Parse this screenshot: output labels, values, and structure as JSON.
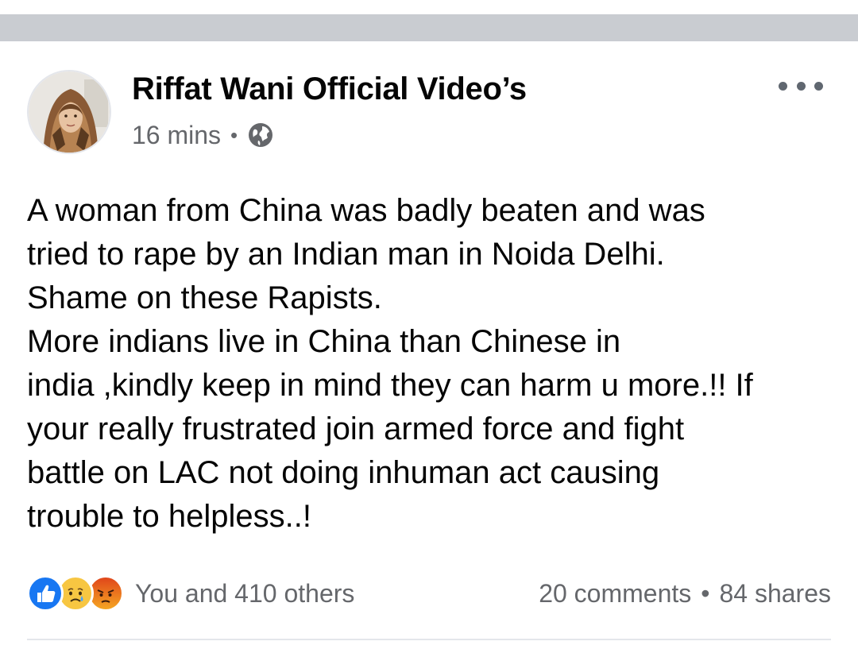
{
  "post": {
    "author": "Riffat Wani Official Video’s",
    "time": "16 mins",
    "separator": "•",
    "privacy_icon": "globe-icon",
    "more_icon": "more-horizontal-icon",
    "text_lines": [
      "A woman from China was badly beaten and was",
      "tried to rape by an Indian man in Noida Delhi.",
      "Shame on these Rapists.",
      "More indians live in China than Chinese in",
      "india ,kindly keep in mind they can harm u more.!! If",
      "your really frustrated join armed force and fight",
      "battle on LAC not doing inhuman act causing",
      "trouble to helpless..!"
    ]
  },
  "footer": {
    "reaction_icons": [
      "like-reaction-icon",
      "sad-reaction-icon",
      "angry-reaction-icon"
    ],
    "reaction_count": "You and 410 others",
    "comments": "20 comments",
    "separator": "•",
    "shares": "84 shares"
  },
  "colors": {
    "band": "#c9ccd1",
    "text_primary": "#050505",
    "text_secondary": "#65676b",
    "like_blue": "#1877f2"
  }
}
